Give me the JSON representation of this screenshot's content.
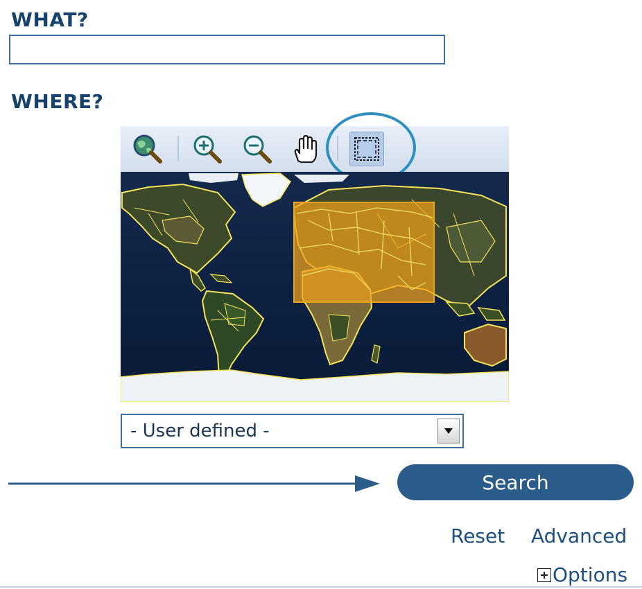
{
  "what": {
    "label": "WHAT?",
    "value": ""
  },
  "where": {
    "label": "WHERE?",
    "toolbar": [
      {
        "icon": "globe-zoom-icon",
        "active": false
      },
      {
        "icon": "zoom-in-icon",
        "active": false
      },
      {
        "icon": "zoom-out-icon",
        "active": false
      },
      {
        "icon": "pan-hand-icon",
        "active": false
      },
      {
        "icon": "select-box-icon",
        "active": true
      }
    ],
    "area_select": {
      "selected": "- User defined -"
    }
  },
  "actions": {
    "search_label": "Search",
    "reset_label": "Reset",
    "advanced_label": "Advanced",
    "options_label": "Options"
  },
  "colors": {
    "heading": "#17426b",
    "accent": "#2c5d8a",
    "link": "#1f4f7e",
    "selection": "#e8a41c",
    "highlight_ring": "#2d8ec0"
  }
}
